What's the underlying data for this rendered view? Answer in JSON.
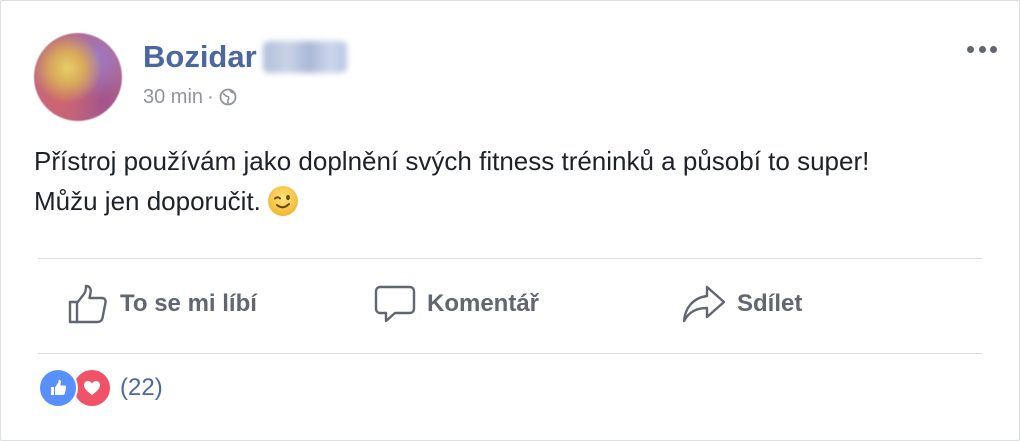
{
  "post": {
    "author_first_name": "Bozidar",
    "timestamp": "30 min",
    "separator": "·",
    "privacy_icon": "globe-icon",
    "menu_icon": "more-options-icon",
    "text_line1": "Přístroj používám jako doplnění svých fitness tréninků a působí to super!",
    "text_line2": "Můžu jen doporučit.",
    "emoji": "winking-face-emoji"
  },
  "actions": {
    "like_label": "To se mi líbí",
    "comment_label": "Komentář",
    "share_label": "Sdílet"
  },
  "reactions": {
    "types": [
      "like",
      "love"
    ],
    "count_label": "(22)"
  },
  "colors": {
    "name_blue": "#4b67a1",
    "meta_gray": "#90949c",
    "action_gray": "#606770",
    "like_blue": "#5890ff",
    "love_red": "#f25268",
    "text": "#1d2129"
  }
}
